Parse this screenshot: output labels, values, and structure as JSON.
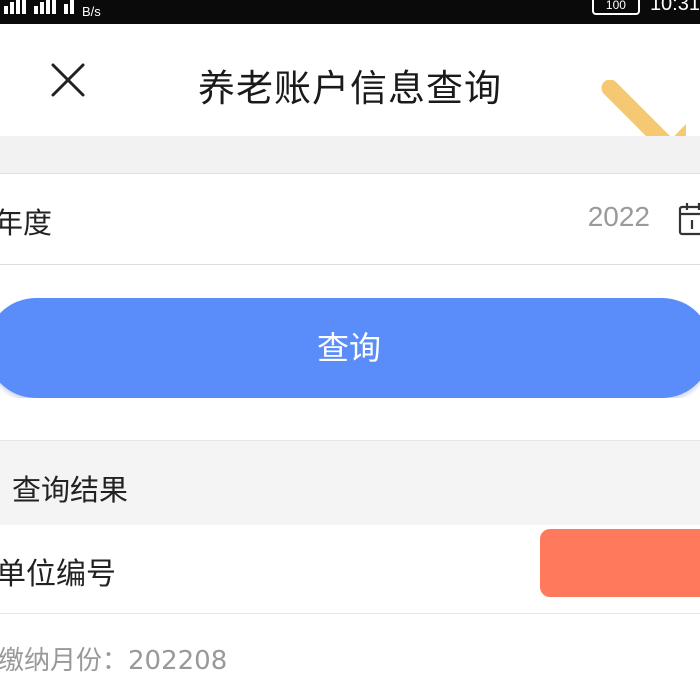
{
  "status_bar": {
    "network_speed_unit": "B/s",
    "battery": "100",
    "time": "10:31"
  },
  "header": {
    "title": "养老账户信息查询",
    "close_icon": "close-icon"
  },
  "annotation": {
    "arrow_color": "#f5c871"
  },
  "form": {
    "year_label": "年度",
    "year_value": "2022",
    "calendar_icon": "calendar-icon"
  },
  "query_button": {
    "label": "查询",
    "color": "#5a8df9"
  },
  "results": {
    "section_title": "查询结果",
    "unit_label": "单位编号",
    "unit_value_color": "#ff7a5c",
    "payment_month_label": "缴纳月份：",
    "payment_month_value": "202208"
  }
}
